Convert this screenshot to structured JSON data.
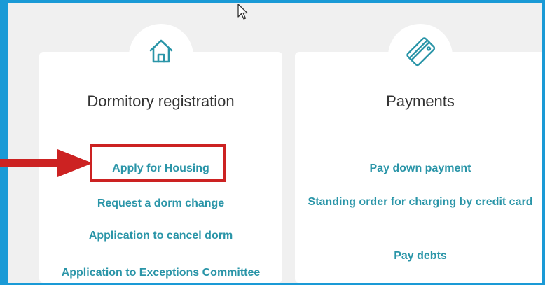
{
  "colors": {
    "frame": "#1a9ad6",
    "background": "#f0f0f0",
    "card": "#ffffff",
    "link": "#2a95a8",
    "title": "#333333",
    "highlight": "#cc2222"
  },
  "dormitory": {
    "icon": "house-icon",
    "title": "Dormitory registration",
    "links": [
      "Apply for Housing",
      "Request a dorm change",
      "Application to cancel dorm",
      "Application to Exceptions Committee"
    ]
  },
  "payments": {
    "icon": "credit-card-icon",
    "title": "Payments",
    "links": [
      "Pay down payment",
      "Standing order for charging by credit card",
      "Pay debts"
    ]
  }
}
